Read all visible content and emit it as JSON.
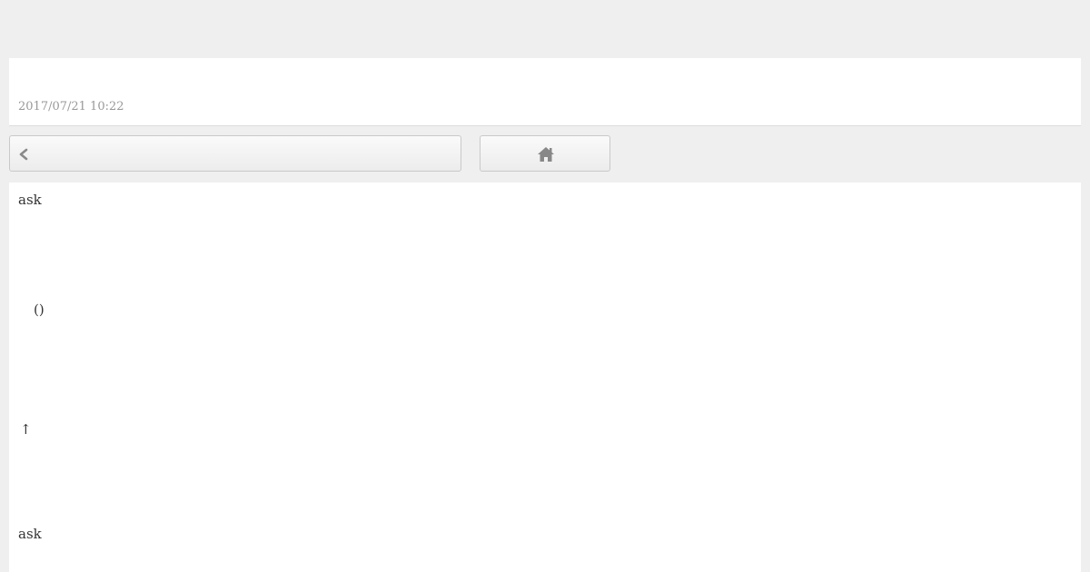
{
  "header": {
    "timestamp": "2017/07/21 10:22"
  },
  "nav": {
    "back_icon": "chevron-left-icon",
    "home_icon": "home-icon",
    "icon_color": "#888888"
  },
  "content": {
    "lines": [
      "ask",
      "()",
      "↑",
      "ask"
    ]
  }
}
